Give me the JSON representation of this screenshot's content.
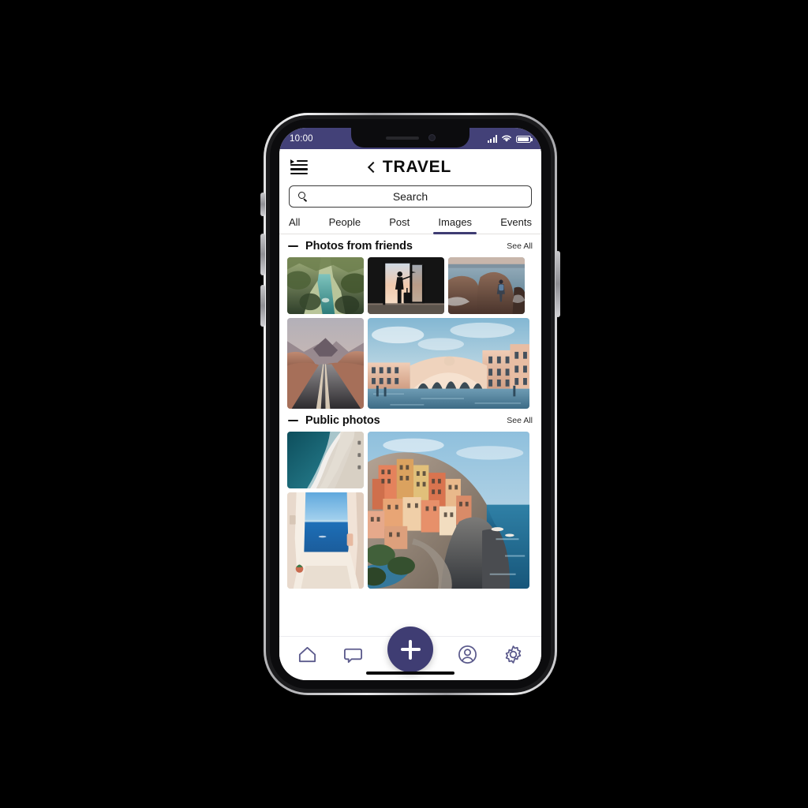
{
  "status_bar": {
    "time": "10:00",
    "signal_icon": "cellular-signal-icon",
    "wifi_icon": "wifi-icon",
    "battery_icon": "battery-icon",
    "background_color": "#434178"
  },
  "header": {
    "menu_icon": "list-menu-icon",
    "back_icon": "back-chevron-icon",
    "title": "TRAVEL"
  },
  "search": {
    "icon": "search-icon",
    "placeholder": "Search",
    "value": "Search"
  },
  "tabs": [
    {
      "label": "All",
      "active": false
    },
    {
      "label": "People",
      "active": false
    },
    {
      "label": "Post",
      "active": false
    },
    {
      "label": "Images",
      "active": true
    },
    {
      "label": "Events",
      "active": false
    }
  ],
  "sections": [
    {
      "title": "Photos from friends",
      "see_all_label": "See All",
      "collapse_icon": "minus-icon",
      "photos": [
        {
          "name": "tropical-jungle-river",
          "alt": "Tropical jungle river with turquoise water"
        },
        {
          "name": "airport-traveler-silhouette",
          "alt": "Silhouette of traveler with suitcase at airport window"
        },
        {
          "name": "coastal-cliff-hiker",
          "alt": "Hiker with backpack on rocky coastal cliff"
        },
        {
          "name": "desert-highway-road",
          "alt": "Empty desert highway between red rock mountains"
        },
        {
          "name": "venice-rialto-bridge",
          "alt": "Rialto Bridge over the Grand Canal in Venice"
        }
      ]
    },
    {
      "title": "Public photos",
      "see_all_label": "See All",
      "collapse_icon": "minus-icon",
      "photos": [
        {
          "name": "aerial-beach-waves",
          "alt": "Aerial view of teal ocean waves meeting pale sand beach"
        },
        {
          "name": "santorini-alley-sea",
          "alt": "White-walled alley looking out over the blue sea"
        },
        {
          "name": "cinque-terre-manarola",
          "alt": "Colorful cliffside village of Manarola, Cinque Terre"
        }
      ]
    }
  ],
  "bottom_nav": {
    "items": [
      {
        "name": "home-icon",
        "label": "Home"
      },
      {
        "name": "chat-icon",
        "label": "Messages"
      },
      {
        "name": "profile-icon",
        "label": "Profile"
      },
      {
        "name": "settings-gear-icon",
        "label": "Settings"
      }
    ],
    "fab": {
      "icon": "plus-icon",
      "label": "Create",
      "color": "#3f3d73"
    },
    "icon_color": "#5b5a8c"
  }
}
